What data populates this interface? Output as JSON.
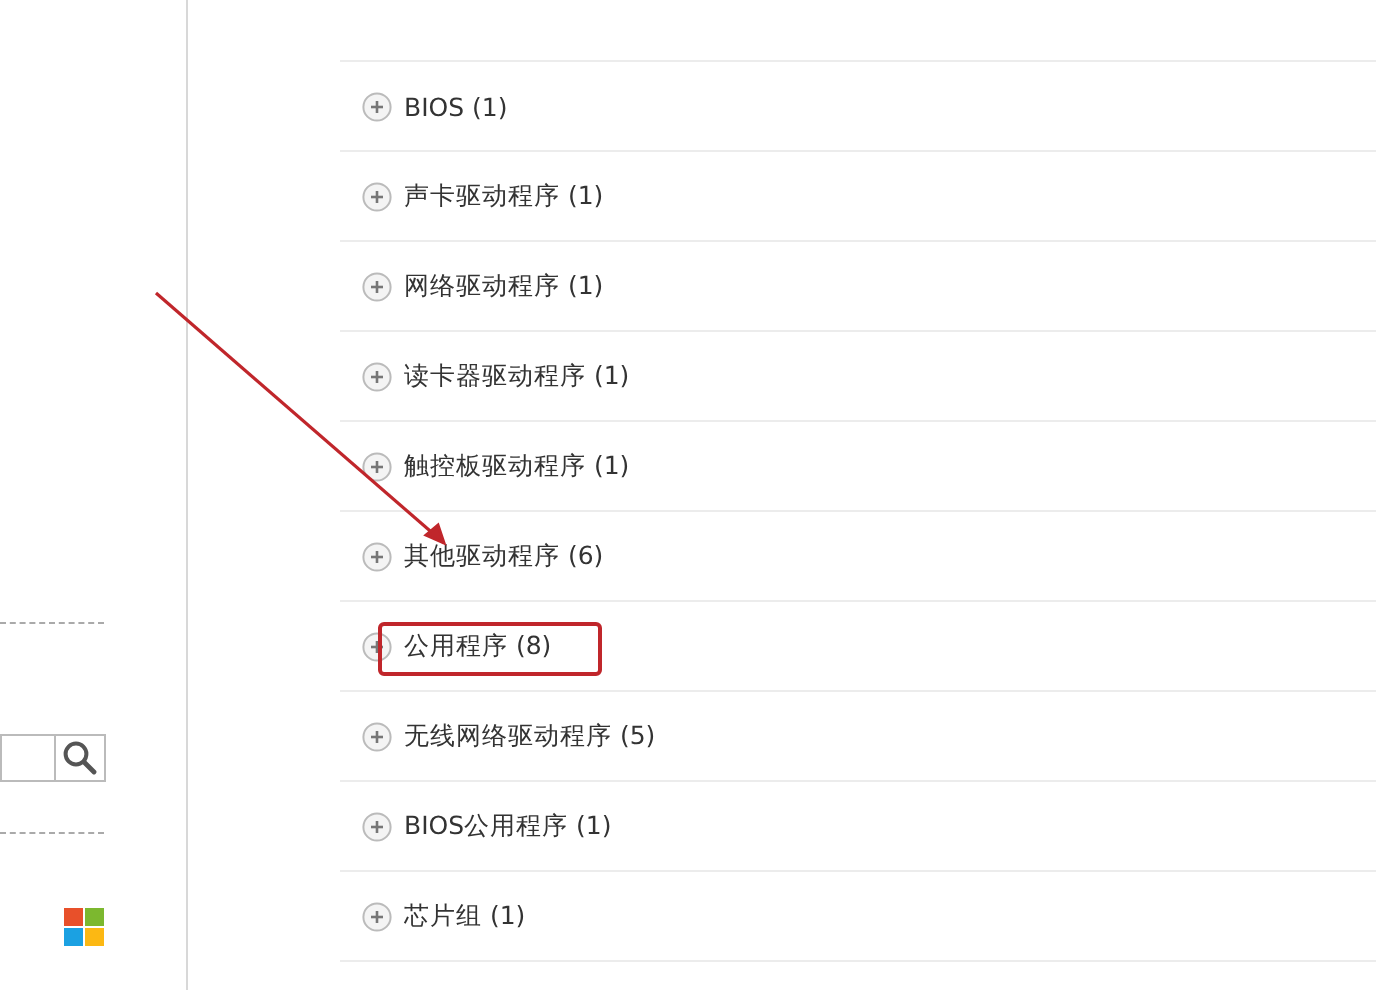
{
  "categories": [
    {
      "label": "BIOS (1)",
      "expanded": false,
      "highlighted": false
    },
    {
      "label": "声卡驱动程序 (1)",
      "expanded": false,
      "highlighted": false
    },
    {
      "label": "网络驱动程序 (1)",
      "expanded": false,
      "highlighted": false
    },
    {
      "label": "读卡器驱动程序 (1)",
      "expanded": false,
      "highlighted": false
    },
    {
      "label": "触控板驱动程序 (1)",
      "expanded": false,
      "highlighted": false
    },
    {
      "label": "其他驱动程序 (6)",
      "expanded": false,
      "highlighted": false
    },
    {
      "label": "公用程序 (8)",
      "expanded": false,
      "highlighted": true
    },
    {
      "label": "无线网络驱动程序 (5)",
      "expanded": false,
      "highlighted": false
    },
    {
      "label": "BIOS公用程序 (1)",
      "expanded": false,
      "highlighted": false
    },
    {
      "label": "芯片组 (1)",
      "expanded": false,
      "highlighted": false
    }
  ]
}
